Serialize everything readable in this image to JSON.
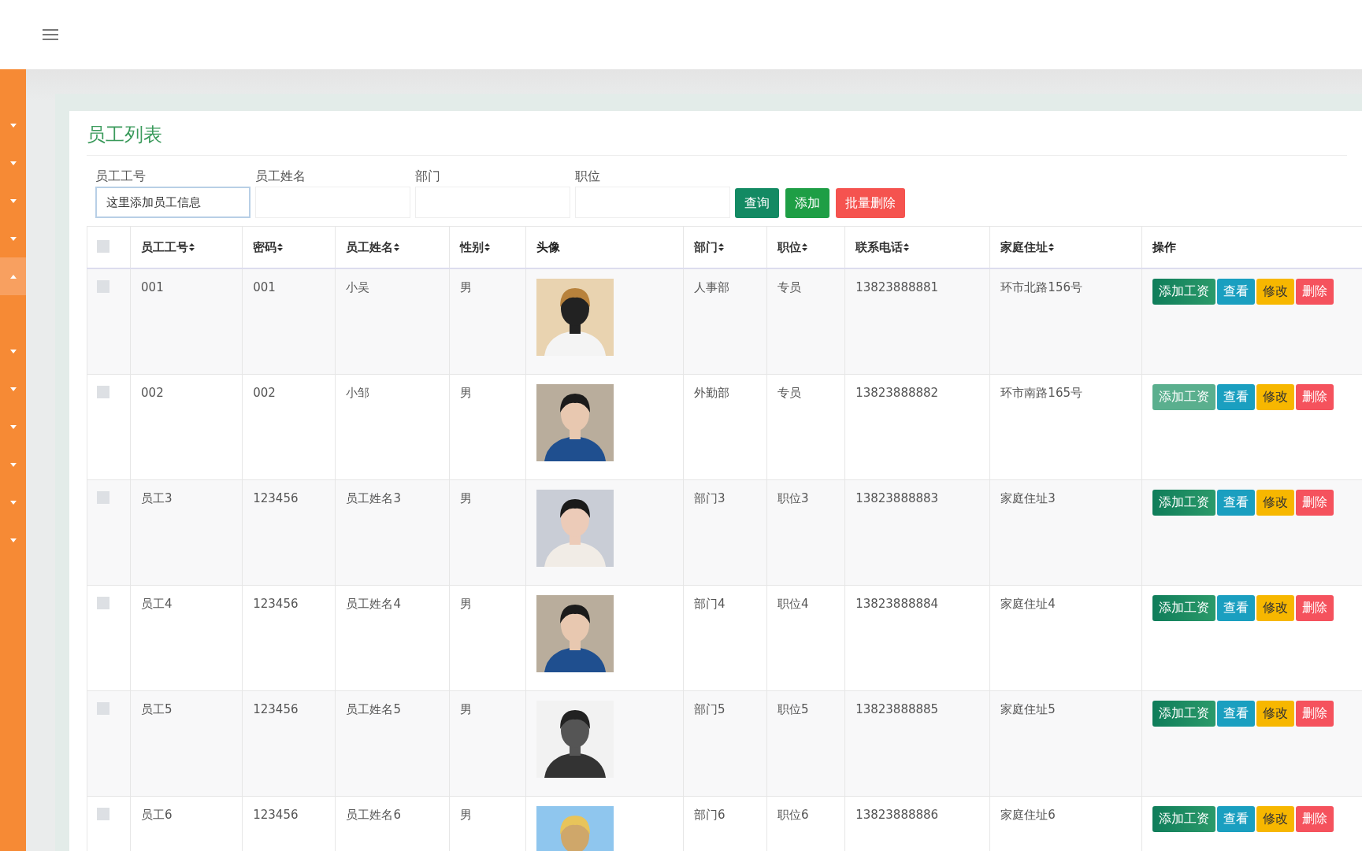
{
  "sidebar": {
    "items": [
      {
        "expanded": false
      },
      {
        "expanded": false
      },
      {
        "expanded": false
      },
      {
        "expanded": false
      },
      {
        "expanded": true
      },
      {
        "expanded": false
      },
      {
        "expanded": false
      },
      {
        "expanded": false
      },
      {
        "expanded": false
      },
      {
        "expanded": false
      },
      {
        "expanded": false
      }
    ]
  },
  "panel": {
    "title": "员工列表"
  },
  "filters": [
    {
      "label": "员工工号",
      "placeholder": "这里添加员工信息",
      "focused": true
    },
    {
      "label": "员工姓名",
      "focused": false
    },
    {
      "label": "部门",
      "focused": false
    },
    {
      "label": "职位",
      "focused": false
    }
  ],
  "filter_buttons": [
    {
      "kind": "query",
      "label": "查询"
    },
    {
      "kind": "add",
      "label": "添加"
    },
    {
      "kind": "delete",
      "label": "批量删除"
    }
  ],
  "table": {
    "select_all": {
      "checked": false
    },
    "columns": [
      {
        "label": "员工工号",
        "sortable": true
      },
      {
        "label": "密码",
        "sortable": true
      },
      {
        "label": "员工姓名",
        "sortable": true
      },
      {
        "label": "性别",
        "sortable": true
      },
      {
        "label": "头像",
        "sortable": false
      },
      {
        "label": "部门",
        "sortable": true
      },
      {
        "label": "职位",
        "sortable": true
      },
      {
        "label": "联系电话",
        "sortable": true
      },
      {
        "label": "家庭住址",
        "sortable": true
      },
      {
        "label": "操作",
        "sortable": false
      }
    ],
    "rows": [
      {
        "checked": false,
        "cells": [
          "001",
          "001",
          "小吴",
          "男"
        ],
        "cells2": [
          "人事部",
          "专员",
          "13823888881",
          "环市北路156号"
        ],
        "actions": [
          {
            "kind": "salary",
            "label": "添加工资",
            "hover": false
          },
          {
            "kind": "view",
            "label": "查看",
            "hover": false
          },
          {
            "kind": "edit",
            "label": "修改",
            "hover": false
          },
          {
            "kind": "delete",
            "label": "删除",
            "hover": false
          }
        ]
      },
      {
        "checked": false,
        "cells": [
          "002",
          "002",
          "小邹",
          "男"
        ],
        "cells2": [
          "外勤部",
          "专员",
          "13823888882",
          "环市南路165号"
        ],
        "actions": [
          {
            "kind": "salary",
            "label": "添加工资",
            "hover": true
          },
          {
            "kind": "view",
            "label": "查看",
            "hover": false
          },
          {
            "kind": "edit",
            "label": "修改",
            "hover": false
          },
          {
            "kind": "delete",
            "label": "删除",
            "hover": false
          }
        ]
      },
      {
        "checked": false,
        "cells": [
          "员工3",
          "123456",
          "员工姓名3",
          "男"
        ],
        "cells2": [
          "部门3",
          "职位3",
          "13823888883",
          "家庭住址3"
        ],
        "actions": [
          {
            "kind": "salary",
            "label": "添加工资",
            "hover": false
          },
          {
            "kind": "view",
            "label": "查看",
            "hover": false
          },
          {
            "kind": "edit",
            "label": "修改",
            "hover": false
          },
          {
            "kind": "delete",
            "label": "删除",
            "hover": false
          }
        ]
      },
      {
        "checked": false,
        "cells": [
          "员工4",
          "123456",
          "员工姓名4",
          "男"
        ],
        "cells2": [
          "部门4",
          "职位4",
          "13823888884",
          "家庭住址4"
        ],
        "actions": [
          {
            "kind": "salary",
            "label": "添加工资",
            "hover": false
          },
          {
            "kind": "view",
            "label": "查看",
            "hover": false
          },
          {
            "kind": "edit",
            "label": "修改",
            "hover": false
          },
          {
            "kind": "delete",
            "label": "删除",
            "hover": false
          }
        ]
      },
      {
        "checked": false,
        "cells": [
          "员工5",
          "123456",
          "员工姓名5",
          "男"
        ],
        "cells2": [
          "部门5",
          "职位5",
          "13823888885",
          "家庭住址5"
        ],
        "actions": [
          {
            "kind": "salary",
            "label": "添加工资",
            "hover": false
          },
          {
            "kind": "view",
            "label": "查看",
            "hover": false
          },
          {
            "kind": "edit",
            "label": "修改",
            "hover": false
          },
          {
            "kind": "delete",
            "label": "删除",
            "hover": false
          }
        ]
      },
      {
        "checked": false,
        "cells": [
          "员工6",
          "123456",
          "员工姓名6",
          "男"
        ],
        "cells2": [
          "部门6",
          "职位6",
          "13823888886",
          "家庭住址6"
        ],
        "actions": [
          {
            "kind": "salary",
            "label": "添加工资",
            "hover": false
          },
          {
            "kind": "view",
            "label": "查看",
            "hover": false
          },
          {
            "kind": "edit",
            "label": "修改",
            "hover": false
          },
          {
            "kind": "delete",
            "label": "删除",
            "hover": false
          }
        ]
      }
    ]
  }
}
